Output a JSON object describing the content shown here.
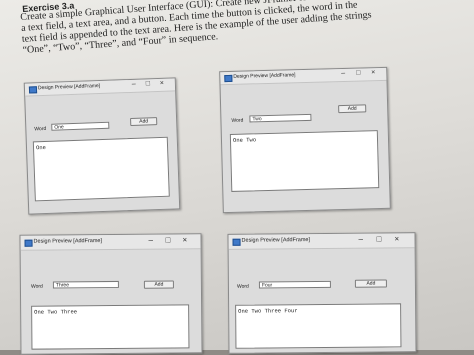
{
  "exercise": {
    "heading": "Exercise 3.a",
    "paragraph_lines": [
      "Create a simple Graphical User Interface (GUI): Create new JFrameForm with a label,",
      "a text field, a text area, and a button. Each time the button is clicked, the word in the",
      "text field is appended to the text area. Here is the example of the user adding the strings",
      "“One”, “Two”, “Three”, and “Four” in sequence."
    ]
  },
  "windows": [
    {
      "title": "Design Preview [AddFrame]",
      "minimize": "–",
      "maximize": "□",
      "close": "×",
      "label": "Word",
      "field_value": "One",
      "button_label": "Add",
      "textarea_value": "One"
    },
    {
      "title": "Design Preview [AddFrame]",
      "minimize": "–",
      "maximize": "□",
      "close": "×",
      "label": "Word",
      "field_value": "Two",
      "button_label": "Add",
      "textarea_value": "One Two"
    },
    {
      "title": "Design Preview [AddFrame]",
      "minimize": "–",
      "maximize": "□",
      "close": "×",
      "label": "Word",
      "field_value": "Three",
      "button_label": "Add",
      "textarea_value": "One Two Three"
    },
    {
      "title": "Design Preview [AddFrame]",
      "minimize": "–",
      "maximize": "□",
      "close": "×",
      "label": "Word",
      "field_value": "Four",
      "button_label": "Add",
      "textarea_value": "One Two Three Four"
    }
  ]
}
